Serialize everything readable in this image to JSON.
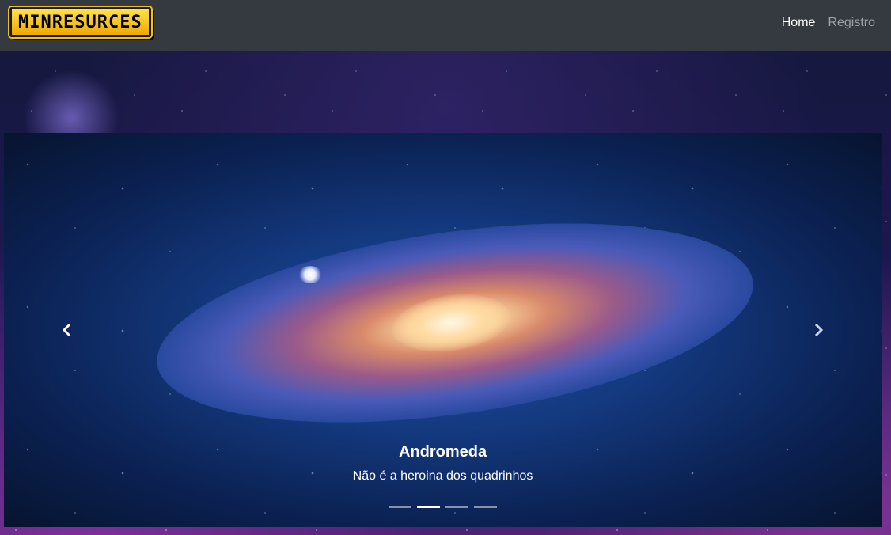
{
  "navbar": {
    "logo_text": "MINRESURCES",
    "links": [
      {
        "label": "Home",
        "active": true
      },
      {
        "label": "Registro",
        "active": false
      }
    ]
  },
  "carousel": {
    "slide_count": 4,
    "active_index": 1,
    "caption": {
      "title": "Andromeda",
      "text": "Não é a heroina dos quadrinhos"
    },
    "prev_icon": "chevron-left-icon",
    "next_icon": "chevron-right-icon"
  },
  "colors": {
    "navbar_bg": "#343a40",
    "nav_active": "#ffffff",
    "nav_inactive": "#9aa0a6",
    "logo_yellow": "#ffe14a"
  }
}
